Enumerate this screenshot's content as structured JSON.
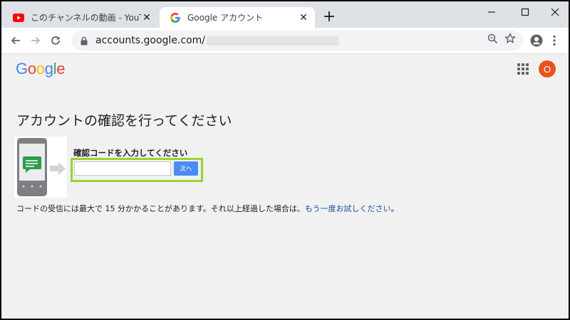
{
  "tabs": [
    {
      "title": "このチャンネルの動画 - YouTube Stu",
      "icon": "youtube-icon",
      "active": false
    },
    {
      "title": "Google アカウント",
      "icon": "google-g-icon",
      "active": true
    }
  ],
  "toolbar": {
    "url_text": "accounts.google.com/"
  },
  "header": {
    "logo_text": "Google",
    "logo_colors": [
      "#4285F4",
      "#EA4335",
      "#FBBC05",
      "#4285F4",
      "#34A853",
      "#EA4335"
    ],
    "avatar_letter": "O",
    "avatar_color": "#E8531D"
  },
  "main": {
    "heading": "アカウントの確認を行ってください",
    "code_label": "確認コードを入力してください",
    "input_value": "",
    "input_placeholder": "",
    "next_button": "次へ",
    "note_text": "コードの受信には最大で 15 分かかることがあります。それ以上経過した場合は、",
    "note_link": "もう一度お試しください",
    "note_end": "。"
  },
  "colors": {
    "highlight": "#9CD230",
    "button": "#4C8BF5",
    "link": "#1A4E9C"
  }
}
